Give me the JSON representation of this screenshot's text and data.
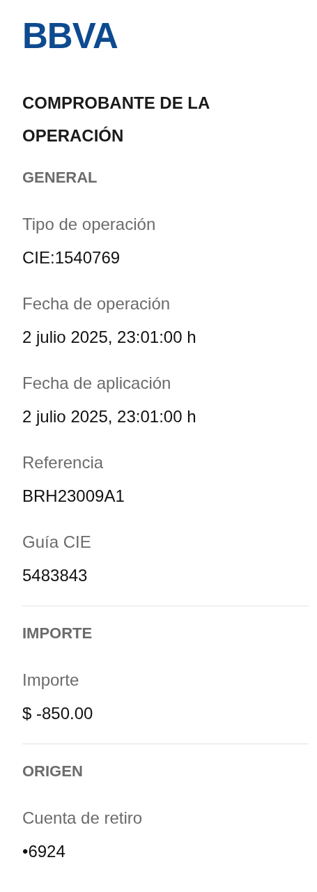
{
  "logo": {
    "text": "BBVA"
  },
  "title": "COMPROBANTE DE LA OPERACIÓN",
  "sections": [
    {
      "heading": "GENERAL",
      "fields": [
        {
          "label": "Tipo de operación",
          "value": "CIE:1540769"
        },
        {
          "label": "Fecha de operación",
          "value": "2 julio 2025, 23:01:00 h"
        },
        {
          "label": "Fecha de aplicación",
          "value": "2 julio 2025, 23:01:00 h"
        },
        {
          "label": "Referencia",
          "value": "BRH23009A1"
        },
        {
          "label": "Guía CIE",
          "value": "5483843"
        }
      ]
    },
    {
      "heading": "IMPORTE",
      "fields": [
        {
          "label": "Importe",
          "value": "$ -850.00"
        }
      ]
    },
    {
      "heading": "ORIGEN",
      "fields": [
        {
          "label": "Cuenta de retiro",
          "value": "•6924"
        }
      ]
    }
  ]
}
